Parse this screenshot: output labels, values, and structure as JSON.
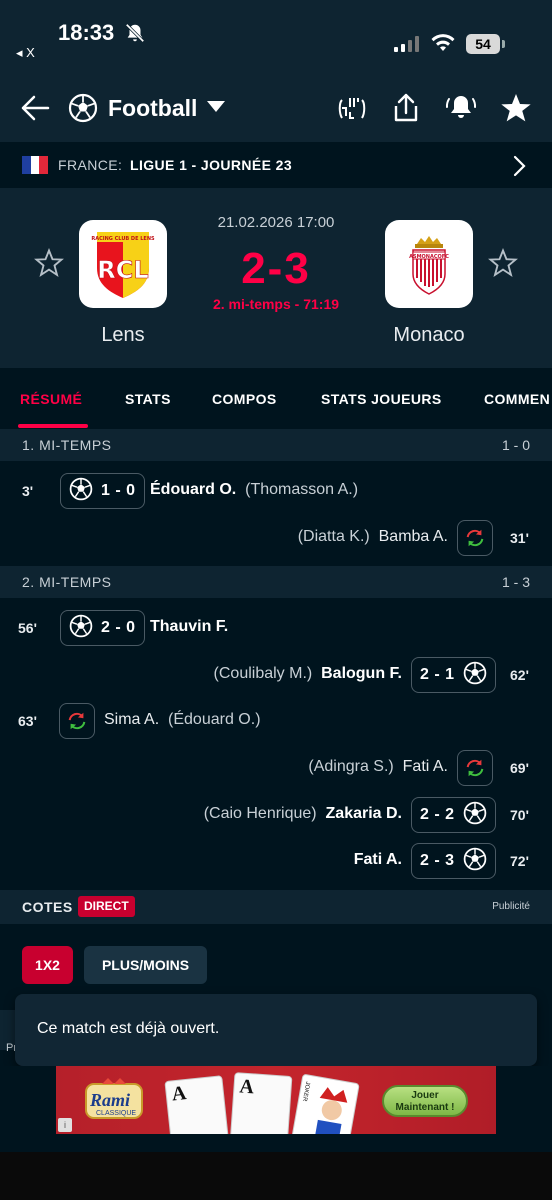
{
  "status_bar": {
    "time": "18:33",
    "back_app": "◂ X",
    "battery": "54"
  },
  "header": {
    "title": "Football"
  },
  "league": {
    "country": "FRANCE:",
    "name": "LIGUE 1 - JOURNÉE 23"
  },
  "match": {
    "date": "21.02.2026 17:00",
    "score": "2-3",
    "status": "2. mi-temps - 71:19",
    "home": {
      "name": "Lens",
      "logo_text": "RCL",
      "logo_caption": "RACING CLUB DE LENS"
    },
    "away": {
      "name": "Monaco",
      "logo_text": "ASMONACOFC"
    }
  },
  "tabs": [
    "RÉSUMÉ",
    "STATS",
    "COMPOS",
    "STATS JOUEURS",
    "COMMEN"
  ],
  "periods": [
    {
      "title": "1. MI-TEMPS",
      "score": "1 - 0"
    },
    {
      "title": "2. MI-TEMPS",
      "score": "1 - 3"
    }
  ],
  "events": [
    {
      "side": "home",
      "type": "goal",
      "minute": "3'",
      "score": "1 - 0",
      "player": "Édouard O.",
      "assist": "(Thomasson A.)"
    },
    {
      "side": "away",
      "type": "sub",
      "minute": "31'",
      "player_in": "Bamba A.",
      "player_out": "(Diatta K.)"
    },
    {
      "side": "home",
      "type": "goal",
      "minute": "56'",
      "score": "2 - 0",
      "player": "Thauvin F.",
      "assist": ""
    },
    {
      "side": "away",
      "type": "goal",
      "minute": "62'",
      "score": "2 - 1",
      "player": "Balogun F.",
      "assist": "(Coulibaly M.)"
    },
    {
      "side": "home",
      "type": "sub",
      "minute": "63'",
      "player_in": "Sima A.",
      "player_out": "(Édouard O.)"
    },
    {
      "side": "away",
      "type": "sub",
      "minute": "69'",
      "player_in": "Fati A.",
      "player_out": "(Adingra S.)"
    },
    {
      "side": "away",
      "type": "goal",
      "minute": "70'",
      "score": "2 - 2",
      "player": "Zakaria D.",
      "assist": "(Caio Henrique)"
    },
    {
      "side": "away",
      "type": "goal",
      "minute": "72'",
      "score": "2 - 3",
      "player": "Fati A.",
      "assist": ""
    }
  ],
  "odds": {
    "title": "COTES",
    "badge": "DIRECT",
    "ad_label": "Publicité",
    "btn_1x2": "1X2",
    "btn_over_under": "PLUS/MOINS"
  },
  "toast": {
    "message": "Ce match est déjà ouvert.",
    "stub": "Pr"
  },
  "ad": {
    "brand": "Rami",
    "brand_sub": "CLASSIQUE",
    "cta": "Jouer Maintenant !",
    "card1": "A",
    "card2": "A",
    "joker": "JOKER",
    "info": "i"
  },
  "colors": {
    "accent": "#ff0046",
    "background": "#00141e",
    "panel": "#0e2431",
    "sub_in": "#3fbf3f",
    "sub_out": "#e8393b"
  }
}
